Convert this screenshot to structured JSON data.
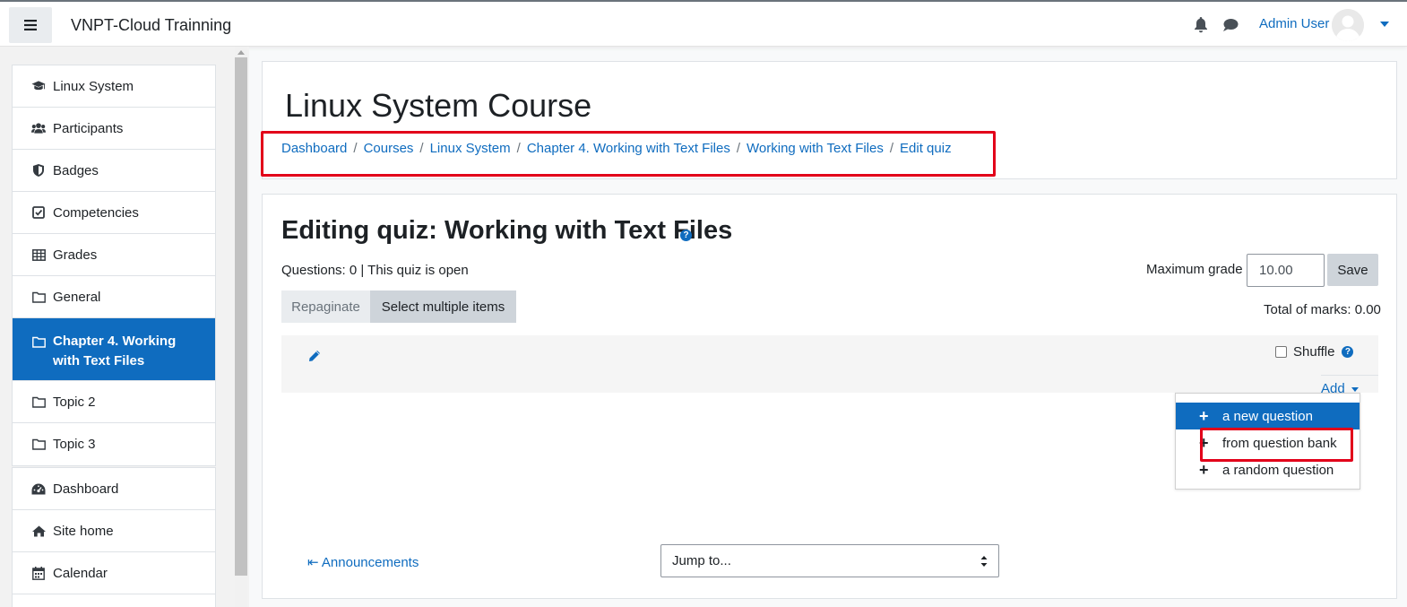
{
  "navbar": {
    "menu_icon": "hamburger-icon",
    "site_name": "VNPT-Cloud Trainning",
    "notifications_icon": "bell-icon",
    "messages_icon": "chat-icon",
    "user_name": "Admin User"
  },
  "sidebar": {
    "items": [
      {
        "label": "Linux System",
        "icon": "graduation-cap-icon"
      },
      {
        "label": "Participants",
        "icon": "users-icon"
      },
      {
        "label": "Badges",
        "icon": "shield-icon"
      },
      {
        "label": "Competencies",
        "icon": "check-square-icon"
      },
      {
        "label": "Grades",
        "icon": "table-icon"
      },
      {
        "label": "General",
        "icon": "folder-icon"
      },
      {
        "label": "Chapter 4. Working with Text Files",
        "icon": "folder-icon",
        "active": true
      },
      {
        "label": "Topic 2",
        "icon": "folder-icon"
      },
      {
        "label": "Topic 3",
        "icon": "folder-icon"
      }
    ],
    "nav": [
      {
        "label": "Dashboard",
        "icon": "tachometer-icon"
      },
      {
        "label": "Site home",
        "icon": "home-icon"
      },
      {
        "label": "Calendar",
        "icon": "calendar-icon"
      }
    ]
  },
  "header": {
    "course_title": "Linux System Course",
    "breadcrumb": [
      "Dashboard",
      "Courses",
      "Linux System",
      "Chapter 4. Working with Text Files",
      "Working with Text Files",
      "Edit quiz"
    ]
  },
  "quiz": {
    "title": "Editing quiz: Working with Text Files",
    "status": "Questions: 0 | This quiz is open",
    "max_grade_label": "Maximum grade",
    "max_grade_value": "10.00",
    "save_label": "Save",
    "repaginate_label": "Repaginate",
    "select_multiple_label": "Select multiple items",
    "total_marks": "Total of marks: 0.00",
    "shuffle_label": "Shuffle",
    "add_label": "Add",
    "add_menu": [
      "a new question",
      "from question bank",
      "a random question"
    ],
    "announcements_link": "Announcements",
    "jump_to_placeholder": "Jump to..."
  },
  "colors": {
    "accent": "#0f6cbf",
    "highlight_box": "#e2001a"
  }
}
